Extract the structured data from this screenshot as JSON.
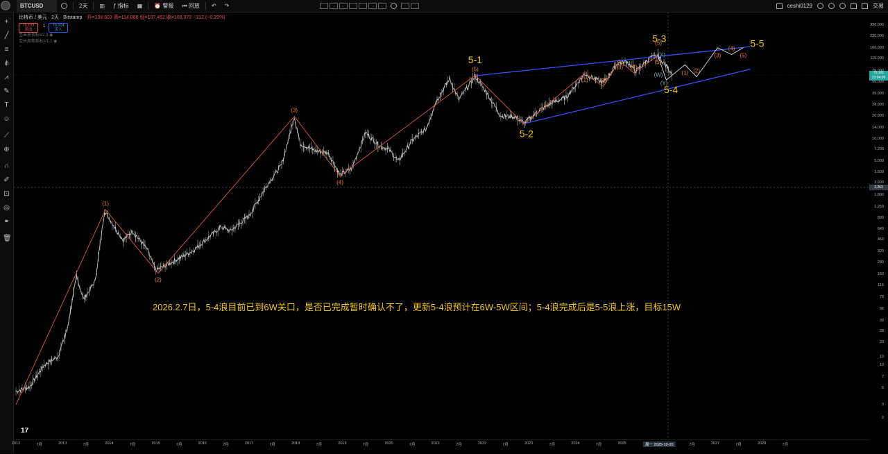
{
  "toolbar": {
    "symbol": "BTCUSD",
    "interval": "2天",
    "indicators_label": "指标",
    "alert_label": "警报",
    "replay_label": "回放",
    "username": "ceshi0129",
    "trade_label": "交易"
  },
  "legend": {
    "title": "比特币 / 美元 · 2天 · Bitstamp",
    "ohlc": "开=108,603 高=114,088 低=107,452 收=108,372 −312 (−0.29%)",
    "sell_price": "70,103",
    "sell_label": "卖出",
    "buy_price": "70,104",
    "buy_label": "买入",
    "spread": "1",
    "indicator_1": "至未来指标V2.3",
    "indicator_2": "至长周期指标V1.1"
  },
  "annotation": "2026.2.7日，5-4浪目前已到6W关口，是否已完成暂时确认不了，更新5-4浪预计在6W-5W区间；5-4浪完成后是5-5浪上涨，目标15W",
  "tv_logo": "17",
  "price_tags": {
    "current": "70,101",
    "current_sub": "23:04:06",
    "crosshair": "2,263"
  },
  "colors": {
    "channel_line": "#3b4ef5",
    "count_line": "#e0583a",
    "wave_label_orange": "#e8832e",
    "wave_label_yellow": "#f1c40f",
    "annotation": "#f1c40f",
    "candle_up": "#e0e0e0",
    "candle_down": "#9e9e9e"
  },
  "chart_data": {
    "type": "line",
    "title": "比特币 / 美元 · 2天 · Bitstamp",
    "y_scale": "log",
    "y_ticks": [
      2,
      3,
      5,
      7,
      10,
      13,
      20,
      28,
      39,
      56,
      79,
      115,
      160,
      230,
      320,
      460,
      640,
      890,
      1250,
      1800,
      2600,
      3600,
      5000,
      7200,
      10000,
      14000,
      20000,
      28000,
      39000,
      56000,
      79000,
      115000,
      160000,
      230000,
      320000
    ],
    "x_ticks": [
      {
        "t": 2012.0,
        "label": "2012"
      },
      {
        "t": 2012.5,
        "label": "7月"
      },
      {
        "t": 2013.0,
        "label": "2013"
      },
      {
        "t": 2013.5,
        "label": "7月"
      },
      {
        "t": 2014.0,
        "label": "2014"
      },
      {
        "t": 2014.5,
        "label": "7月"
      },
      {
        "t": 2015.0,
        "label": "2015"
      },
      {
        "t": 2015.5,
        "label": "7月"
      },
      {
        "t": 2016.0,
        "label": "2016"
      },
      {
        "t": 2016.5,
        "label": "7月"
      },
      {
        "t": 2017.0,
        "label": "2017"
      },
      {
        "t": 2017.5,
        "label": "7月"
      },
      {
        "t": 2018.0,
        "label": "2018"
      },
      {
        "t": 2018.5,
        "label": "7月"
      },
      {
        "t": 2019.0,
        "label": "2019"
      },
      {
        "t": 2019.5,
        "label": "7月"
      },
      {
        "t": 2020.0,
        "label": "2020"
      },
      {
        "t": 2020.5,
        "label": "7月"
      },
      {
        "t": 2021.0,
        "label": "2021"
      },
      {
        "t": 2021.5,
        "label": "7月"
      },
      {
        "t": 2022.0,
        "label": "2022"
      },
      {
        "t": 2022.5,
        "label": "7月"
      },
      {
        "t": 2023.0,
        "label": "2023"
      },
      {
        "t": 2023.5,
        "label": "7月"
      },
      {
        "t": 2024.0,
        "label": "2024"
      },
      {
        "t": 2024.5,
        "label": "7月"
      },
      {
        "t": 2025.0,
        "label": "2025"
      },
      {
        "t": 2025.8,
        "label": "周一 2025-10-20",
        "highlight": true
      },
      {
        "t": 2026.5,
        "label": "7月"
      },
      {
        "t": 2027.0,
        "label": "2027"
      },
      {
        "t": 2027.5,
        "label": "7月"
      },
      {
        "t": 2028.0,
        "label": "2028"
      },
      {
        "t": 2028.5,
        "label": "7月"
      }
    ],
    "price_path": [
      [
        2012.0,
        4.5
      ],
      [
        2012.3,
        5.2
      ],
      [
        2012.6,
        10
      ],
      [
        2012.9,
        13
      ],
      [
        2013.1,
        30
      ],
      [
        2013.3,
        150
      ],
      [
        2013.45,
        75
      ],
      [
        2013.7,
        130
      ],
      [
        2013.9,
        1100
      ],
      [
        2014.1,
        700
      ],
      [
        2014.3,
        450
      ],
      [
        2014.5,
        600
      ],
      [
        2014.8,
        350
      ],
      [
        2015.0,
        180
      ],
      [
        2015.4,
        240
      ],
      [
        2015.8,
        330
      ],
      [
        2016.0,
        420
      ],
      [
        2016.4,
        680
      ],
      [
        2016.6,
        600
      ],
      [
        2017.0,
        950
      ],
      [
        2017.4,
        2500
      ],
      [
        2017.7,
        4500
      ],
      [
        2017.97,
        19500
      ],
      [
        2018.1,
        8500
      ],
      [
        2018.4,
        7000
      ],
      [
        2018.7,
        6400
      ],
      [
        2018.95,
        3300
      ],
      [
        2019.2,
        4000
      ],
      [
        2019.5,
        12000
      ],
      [
        2019.8,
        8000
      ],
      [
        2020.0,
        7200
      ],
      [
        2020.2,
        5000
      ],
      [
        2020.5,
        9500
      ],
      [
        2020.8,
        13500
      ],
      [
        2021.0,
        30000
      ],
      [
        2021.3,
        62000
      ],
      [
        2021.5,
        33000
      ],
      [
        2021.85,
        67000
      ],
      [
        2022.1,
        40000
      ],
      [
        2022.4,
        20000
      ],
      [
        2022.7,
        19500
      ],
      [
        2022.9,
        16000
      ],
      [
        2023.2,
        23000
      ],
      [
        2023.5,
        30000
      ],
      [
        2023.8,
        35000
      ],
      [
        2024.2,
        72000
      ],
      [
        2024.6,
        55000
      ],
      [
        2024.9,
        99000
      ],
      [
        2025.1,
        105000
      ],
      [
        2025.3,
        78000
      ],
      [
        2025.6,
        118000
      ],
      [
        2025.77,
        124000
      ],
      [
        2025.85,
        108000
      ],
      [
        2026.1,
        70000
      ]
    ],
    "primary_count": [
      {
        "t": 2012.0,
        "p": 3.0
      },
      {
        "t": 2013.92,
        "p": 1150,
        "label": "(1)"
      },
      {
        "t": 2015.05,
        "p": 165,
        "label": "(2)"
      },
      {
        "t": 2017.97,
        "p": 19700,
        "label": "(3)"
      },
      {
        "t": 2018.95,
        "p": 3200,
        "label": "(4)"
      },
      {
        "t": 2021.85,
        "p": 69000,
        "label": "(5)"
      }
    ],
    "wave5_count": [
      {
        "t": 2021.85,
        "p": 69000
      },
      {
        "t": 2022.9,
        "p": 15500
      },
      {
        "t": 2024.2,
        "p": 73000,
        "label": "(1)"
      },
      {
        "t": 2024.6,
        "p": 49000,
        "label": "(2)"
      },
      {
        "t": 2024.95,
        "p": 108000,
        "label": "(3)"
      },
      {
        "t": 2025.25,
        "p": 74000,
        "label": "(4)"
      },
      {
        "t": 2025.77,
        "p": 126000,
        "label": "(5)"
      }
    ],
    "projection": [
      {
        "t": 2025.77,
        "p": 126000
      },
      {
        "t": 2025.95,
        "p": 60000,
        "label": "5-4"
      },
      {
        "t": 2026.35,
        "p": 95000,
        "label": "(1)"
      },
      {
        "t": 2026.6,
        "p": 66000,
        "label": "(2)"
      },
      {
        "t": 2027.05,
        "p": 160000,
        "label": "(3)"
      },
      {
        "t": 2027.35,
        "p": 130000,
        "label": "(4)"
      },
      {
        "t": 2027.6,
        "p": 160000,
        "label": "(5)"
      }
    ],
    "channel": {
      "upper": [
        [
          2021.85,
          68000
        ],
        [
          2027.75,
          165000
        ]
      ],
      "lower": [
        [
          2022.9,
          15800
        ],
        [
          2027.75,
          83000
        ]
      ]
    },
    "labels": [
      {
        "t": 2021.85,
        "p": 100000,
        "text": "5-1",
        "big": true
      },
      {
        "t": 2022.95,
        "p": 10500,
        "text": "5-2",
        "big": true
      },
      {
        "t": 2025.8,
        "p": 190000,
        "text": "5-3",
        "big": true
      },
      {
        "t": 2026.05,
        "p": 40000,
        "text": "5-4",
        "big": true
      },
      {
        "t": 2027.9,
        "p": 165000,
        "text": "5-5",
        "big": true
      },
      {
        "t": 2025.78,
        "p": 175000,
        "text": "(5)"
      },
      {
        "t": 2025.85,
        "p": 122000,
        "text": "(X)",
        "teal": true
      },
      {
        "t": 2025.78,
        "p": 66000,
        "text": "(W)",
        "teal": true
      },
      {
        "t": 2025.9,
        "p": 51000,
        "text": "(Y)",
        "teal": true
      }
    ]
  }
}
